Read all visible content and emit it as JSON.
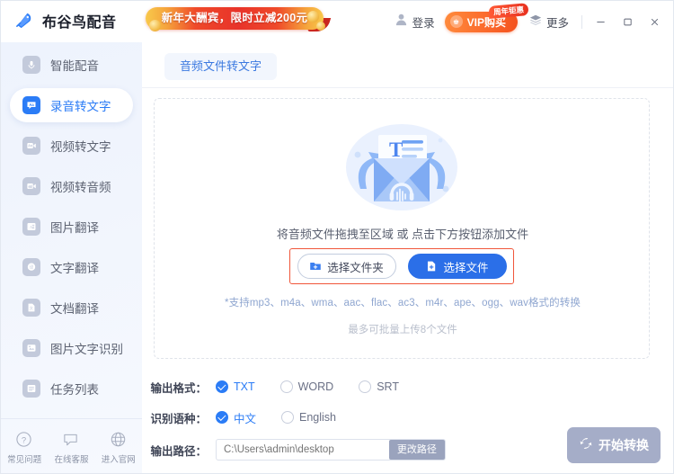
{
  "window": {
    "app_name": "布谷鸟配音",
    "logo_icon": "bird-logo-icon",
    "promo_banner": "新年大酬宾，限时立减200元",
    "login_label": "登录",
    "login_icon": "user-avatar-icon",
    "vip_label": "VIP购买",
    "vip_icon": "crown-icon",
    "vip_badge": "周年钜惠",
    "more_label": "更多",
    "more_icon": "layers-icon",
    "minimize_icon": "minimize-icon",
    "maximize_icon": "maximize-icon",
    "close_icon": "close-icon",
    "accent_color": "#2b7cf6",
    "promo_color": "#e8332a"
  },
  "sidebar": {
    "items": [
      {
        "label": "智能配音",
        "icon": "mic-icon",
        "active": false
      },
      {
        "label": "录音转文字",
        "icon": "speech-aa-icon",
        "active": true
      },
      {
        "label": "视频转文字",
        "icon": "video-aa-icon",
        "active": false
      },
      {
        "label": "视频转音频",
        "icon": "video-audio-icon",
        "active": false
      },
      {
        "label": "图片翻译",
        "icon": "image-translate-icon",
        "active": false
      },
      {
        "label": "文字翻译",
        "icon": "text-translate-icon",
        "active": false
      },
      {
        "label": "文档翻译",
        "icon": "doc-translate-icon",
        "active": false
      },
      {
        "label": "图片文字识别",
        "icon": "ocr-icon",
        "active": false
      },
      {
        "label": "任务列表",
        "icon": "task-list-icon",
        "active": false
      }
    ],
    "footer": [
      {
        "label": "常见问题",
        "icon": "question-circle-icon"
      },
      {
        "label": "在线客服",
        "icon": "chat-bubble-icon"
      },
      {
        "label": "进入官网",
        "icon": "globe-icon"
      }
    ]
  },
  "main": {
    "tabs": [
      {
        "label": "音频文件转文字",
        "active": true
      }
    ],
    "dropzone": {
      "illustration_icon": "audio-to-text-envelope-icon",
      "hint": "将音频文件拖拽至区域 或 点击下方按钮添加文件",
      "select_folder_label": "选择文件夹",
      "select_folder_icon": "folder-plus-icon",
      "select_file_label": "选择文件",
      "select_file_icon": "file-plus-icon",
      "highlight_color": "#f0563a",
      "format_note": "*支持mp3、m4a、wma、aac、flac、ac3、m4r、ape、ogg、wav格式的转换",
      "batch_note": "最多可批量上传8个文件"
    },
    "settings": {
      "output_format_label": "输出格式：",
      "output_format_options": [
        {
          "label": "TXT",
          "selected": true
        },
        {
          "label": "WORD",
          "selected": false
        },
        {
          "label": "SRT",
          "selected": false
        }
      ],
      "language_label": "识别语种：",
      "language_options": [
        {
          "label": "中文",
          "selected": true
        },
        {
          "label": "English",
          "selected": false
        }
      ],
      "output_path_label": "输出路径：",
      "output_path_value": "C:\\Users\\admin\\desktop",
      "output_path_placeholder": "C:\\Users\\admin\\desktop",
      "change_path_label": "更改路径"
    },
    "start_button": {
      "label": "开始转换",
      "icon": "convert-arrows-icon"
    }
  }
}
